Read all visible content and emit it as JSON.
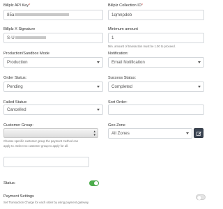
{
  "colors": {
    "toggle_on": "#4cae4c",
    "edit_button": "#3a4452",
    "required": "#d9534f"
  },
  "api_key": {
    "label": "Billplz API Key",
    "required_mark": "*",
    "value_prefix": "85a"
  },
  "collection_id": {
    "label": "Billplz Collection ID",
    "required_mark": "*",
    "value": "1qmnpdeb"
  },
  "x_signature": {
    "label": "Billplz X Signature",
    "value_prefix": "S-U"
  },
  "minimum_amount": {
    "label": "Minimum amount",
    "value": "1",
    "help": "Min. amount of transaction must be 1.00 to proceed."
  },
  "mode": {
    "label": "Production/Sandbox Mode",
    "selected": "Production"
  },
  "notification": {
    "label": "Notification:",
    "selected": "Email Notification"
  },
  "order_status": {
    "label": "Order Status:",
    "selected": "Pending"
  },
  "success_status": {
    "label": "Success Status:",
    "selected": "Completed"
  },
  "failed_status": {
    "label": "Failed Status:",
    "selected": "Cancelled"
  },
  "sort_order": {
    "label": "Sort Order:",
    "value": ""
  },
  "customer_group": {
    "label": "Customer Group:",
    "help_line1": "Choose specific customer group the payment method can",
    "help_line2": "apply to. Select no customer group to apply for all."
  },
  "geo_zone": {
    "label": "Geo Zone",
    "selected": "All Zones",
    "edit_icon": "edit-icon"
  },
  "status": {
    "label": "Status:",
    "enabled": true
  },
  "payment_settings": {
    "label": "Payment Settings",
    "help": "Set Transaction Charge for each order by using payment gateway.",
    "enabled": false
  }
}
